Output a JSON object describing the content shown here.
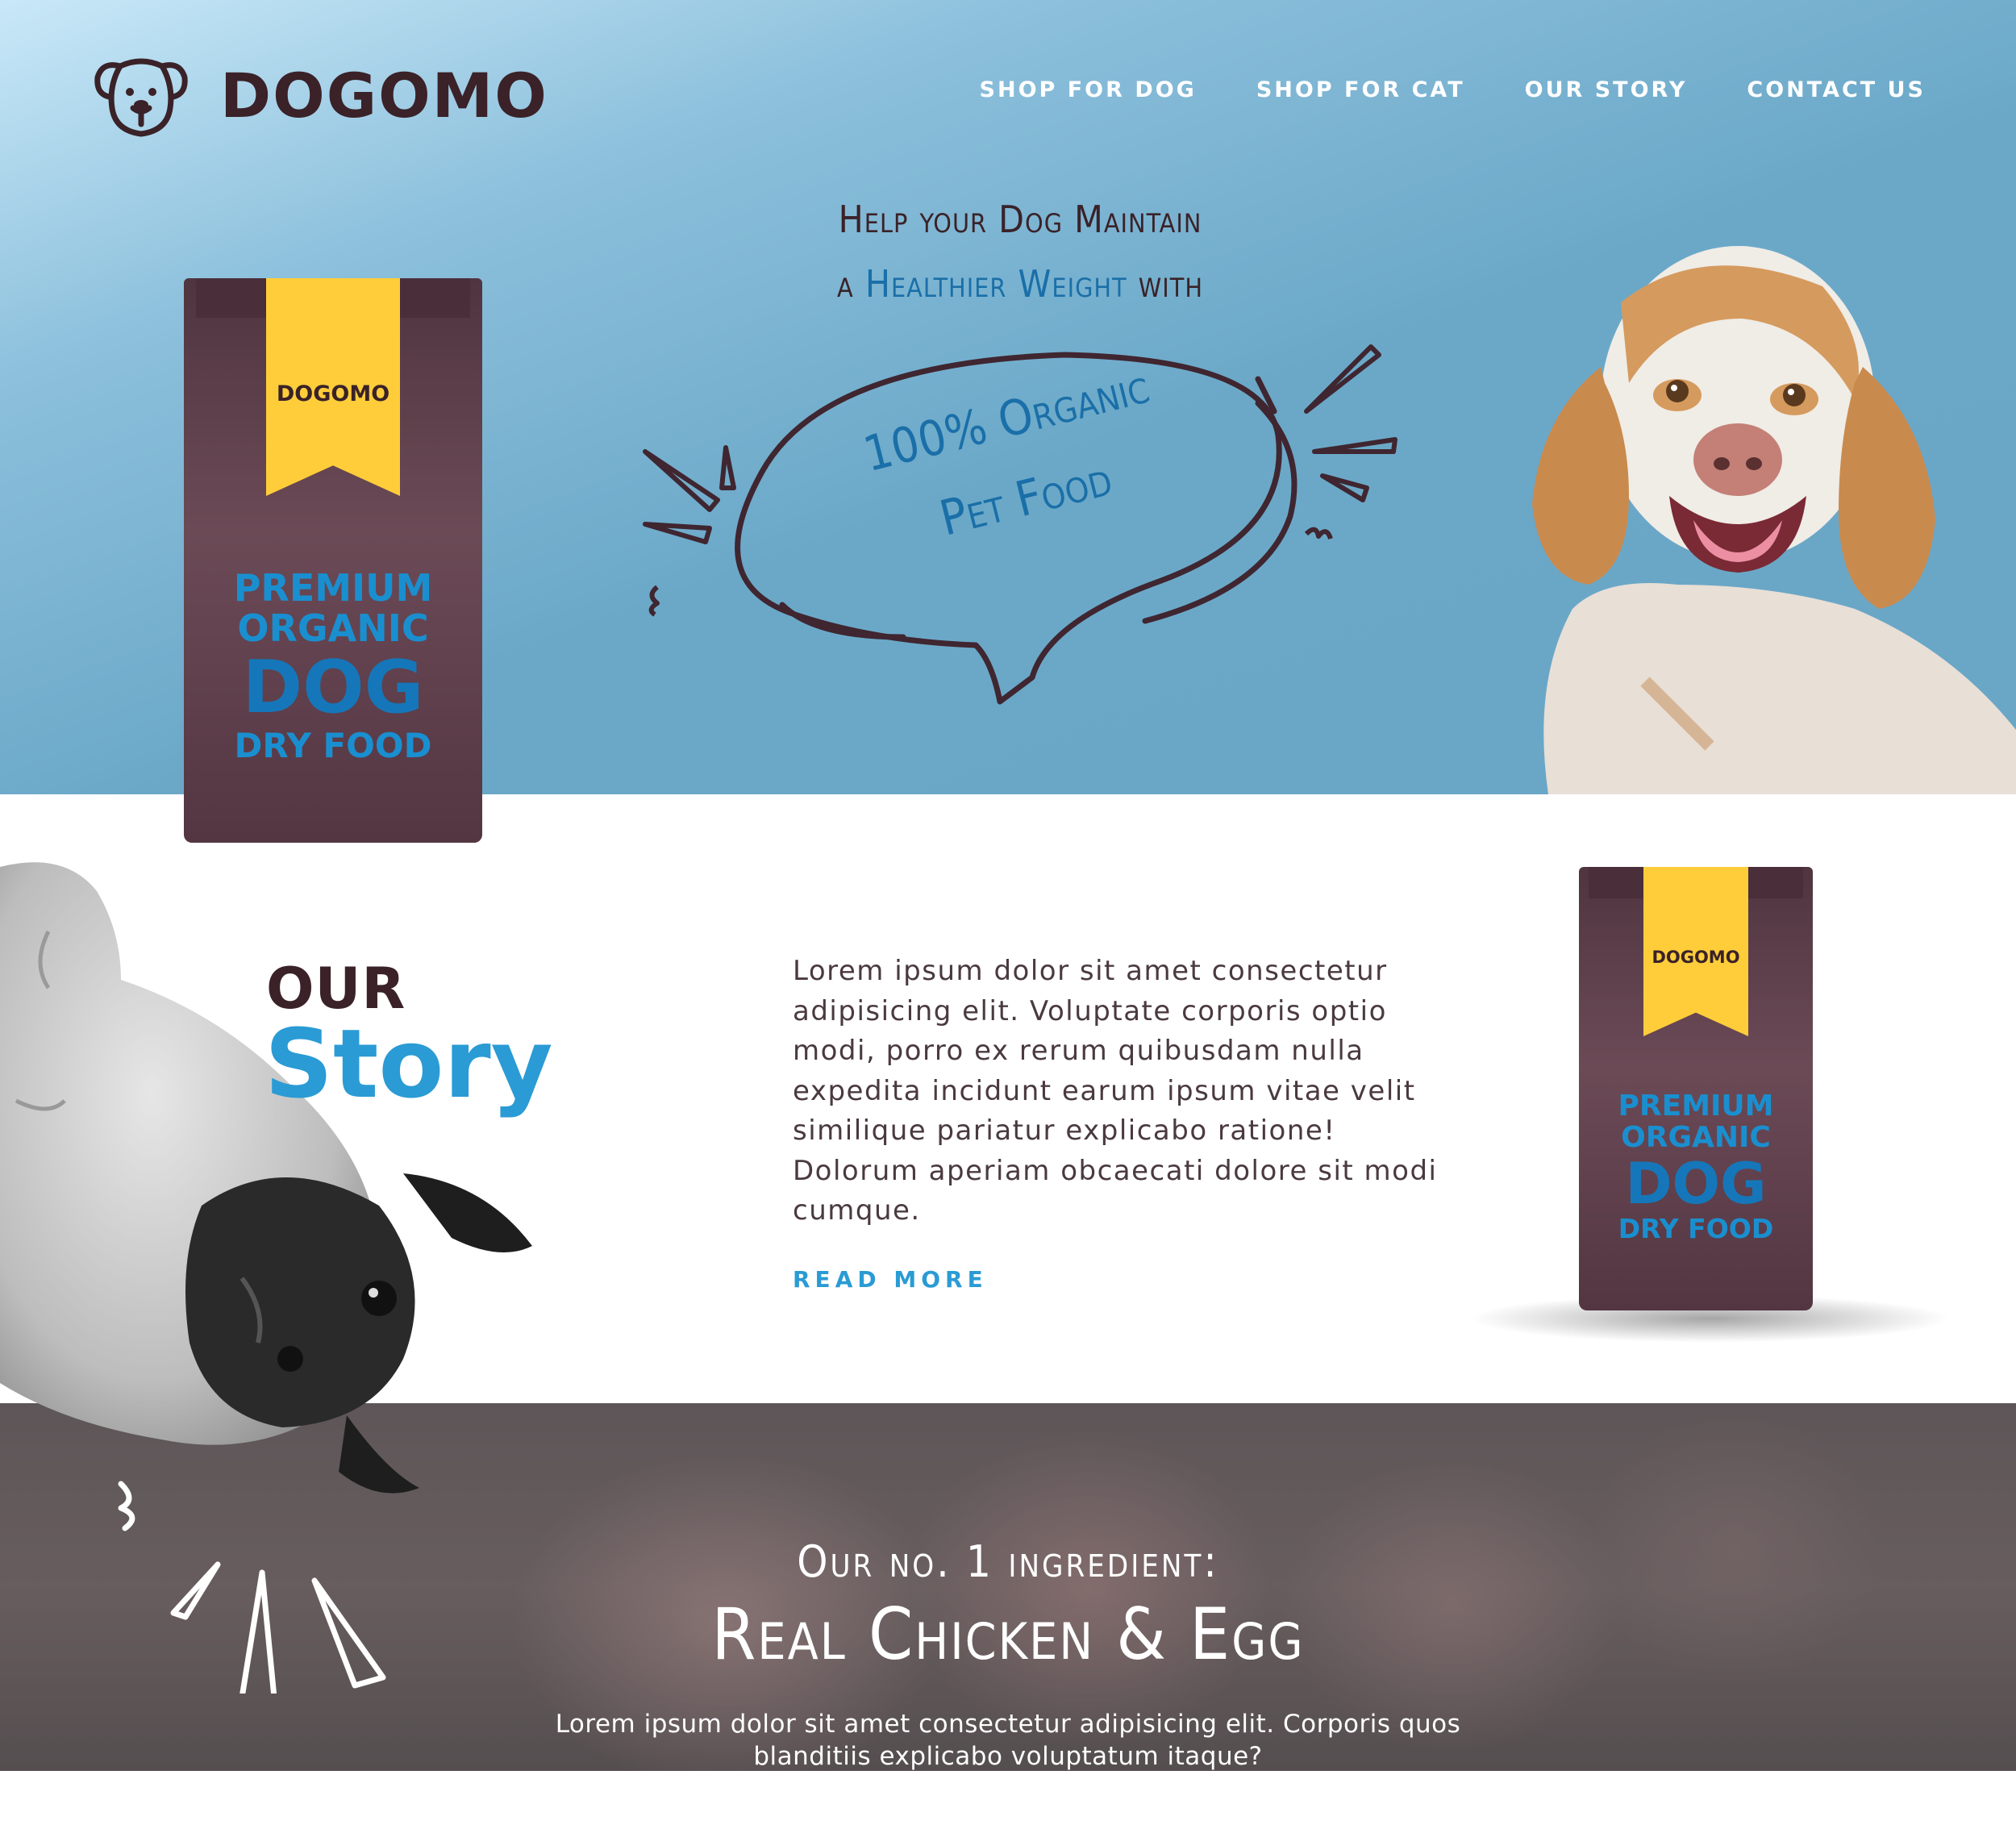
{
  "brand": {
    "name": "DOGOMO"
  },
  "nav": {
    "items": [
      "SHOP FOR DOG",
      "SHOP FOR CAT",
      "OUR STORY",
      "CONTACT US"
    ]
  },
  "hero": {
    "tagline_line1": "Help your Dog Maintain",
    "tagline_line2_pre": "a ",
    "tagline_line2_highlight": "Healthier Weight",
    "tagline_line2_post": " with",
    "bubble_line1": "100% Organic",
    "bubble_line2": "Pet Food"
  },
  "product": {
    "brand": "DOGOMO",
    "line1": "PREMIUM",
    "line2": "ORGANIC",
    "line3": "DOG",
    "line4": "DRY FOOD"
  },
  "story": {
    "heading_small": "OUR",
    "heading_big": "Story",
    "body": "Lorem ipsum dolor sit amet consectetur adipisicing elit. Voluptate corporis optio modi, porro ex rerum quibusdam nulla expedita incidunt earum ipsum vitae velit similique pariatur explicabo ratione! Dolorum aperiam obcaecati dolore sit modi cumque.",
    "read_more": "READ MORE"
  },
  "ingredient": {
    "kicker": "Our no. 1 ingredient:",
    "title": "Real Chicken & Egg",
    "body": "Lorem ipsum dolor sit amet consectetur adipisicing elit. Corporis quos blanditiis explicabo voluptatum itaque?"
  },
  "colors": {
    "brand_dark": "#3a2228",
    "accent_blue": "#2a9bd4",
    "ribbon_yellow": "#ffcd3a",
    "hero_blue": "#6aa6c6"
  },
  "icons": [
    "dog-face-icon",
    "speech-bubble-doodle",
    "burst-doodle"
  ]
}
